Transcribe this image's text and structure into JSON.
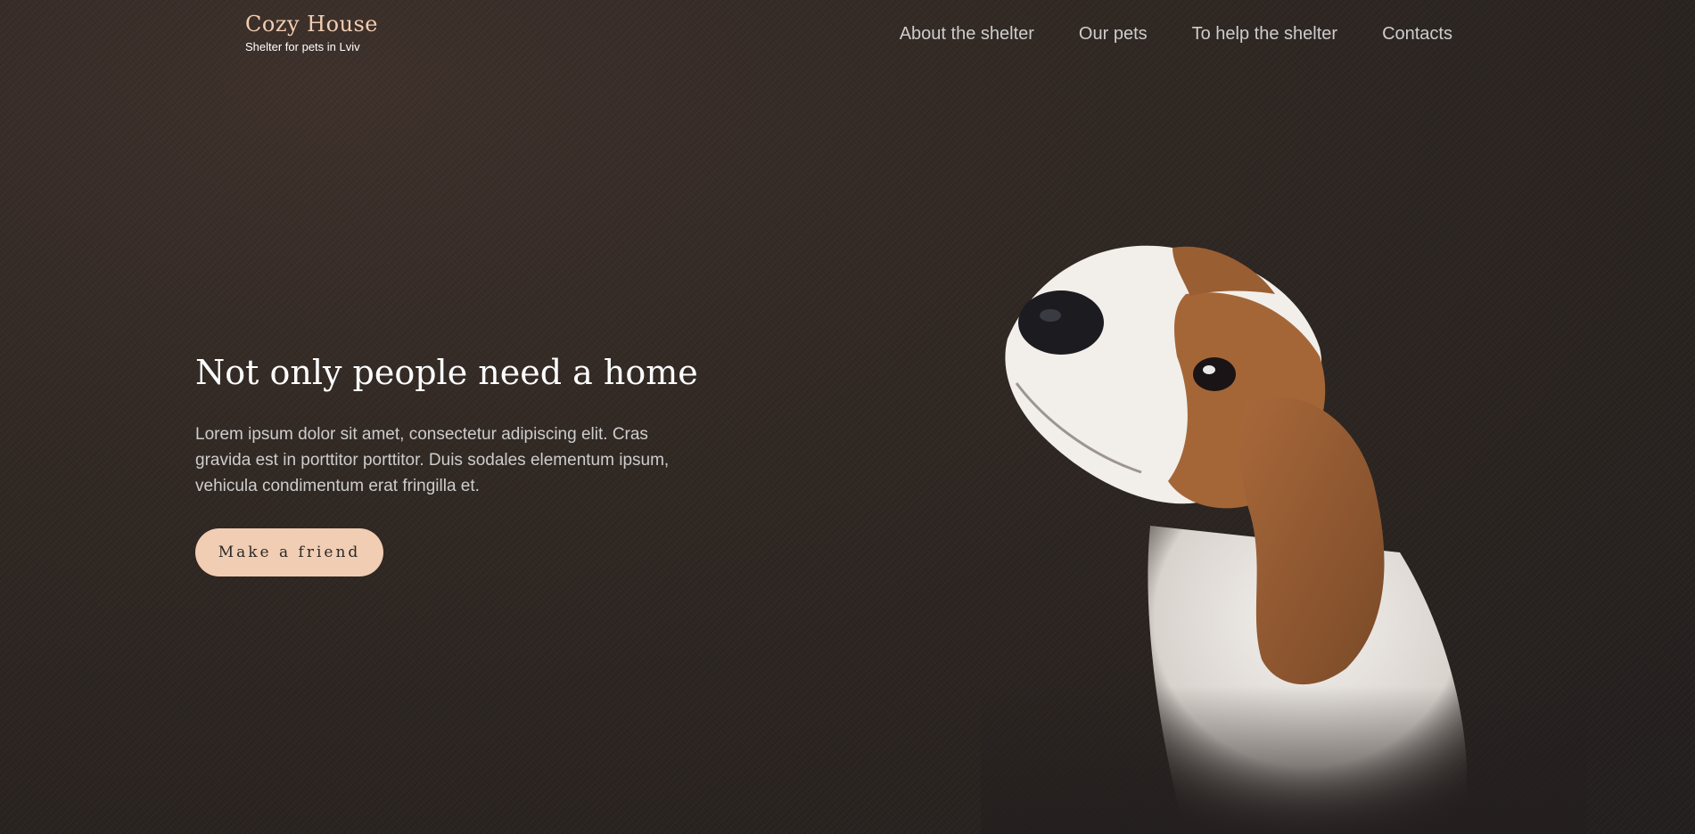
{
  "header": {
    "logo_title": "Cozy House",
    "logo_subtitle": "Shelter for pets in Lviv",
    "nav": [
      {
        "label": "About the shelter"
      },
      {
        "label": "Our pets"
      },
      {
        "label": "To help the shelter"
      },
      {
        "label": "Contacts"
      }
    ]
  },
  "hero": {
    "title": "Not only people need a home",
    "text": "Lorem ipsum dolor sit amet, consectetur adipiscing elit. Cras gravida est in porttitor porttitor. Duis sodales elementum ipsum, vehicula condimentum erat fringilla et.",
    "button_label": "Make a friend",
    "image": "beagle-puppy"
  },
  "colors": {
    "accent": "#f1cdb3",
    "background": "#2f2621",
    "nav_text": "#cdcdcd",
    "title_text": "#ffffff"
  }
}
